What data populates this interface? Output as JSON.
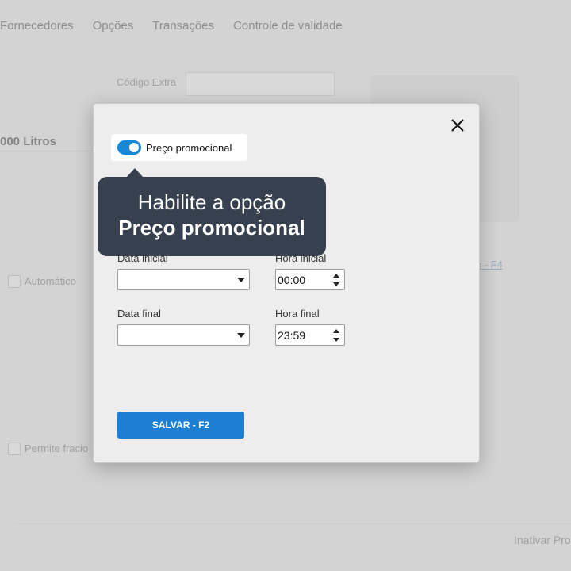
{
  "background": {
    "tabs": [
      "Fornecedores",
      "Opções",
      "Transações",
      "Controle de validade"
    ],
    "extra_code_label": "Código Extra",
    "product_name": "000 Litros",
    "auto_checkbox_label": "Automático",
    "fraction_checkbox_label": "Permite fracio",
    "link_text": "e - F4",
    "bottom_action": "Inativar Pro"
  },
  "modal": {
    "toggle_label": "Preço promocional",
    "toggle_on": true,
    "tooltip": {
      "line1": "Habilite a opção",
      "line2": "Preço promocional"
    },
    "start_date_label": "Data inicial",
    "start_date_value": "",
    "start_time_label": "Hora inicial",
    "start_time_value": "00:00",
    "end_date_label": "Data final",
    "end_date_value": "",
    "end_time_label": "Hora final",
    "end_time_value": "23:59",
    "save_button": "SALVAR - F2"
  },
  "colors": {
    "accent": "#1c7fd4",
    "tooltip_bg": "#36404e",
    "toggle_on": "#1787d8"
  },
  "icons": {
    "close": "close-icon",
    "dropdown": "chevron-down-icon",
    "spinner_up": "caret-up-icon",
    "spinner_down": "caret-down-icon"
  }
}
